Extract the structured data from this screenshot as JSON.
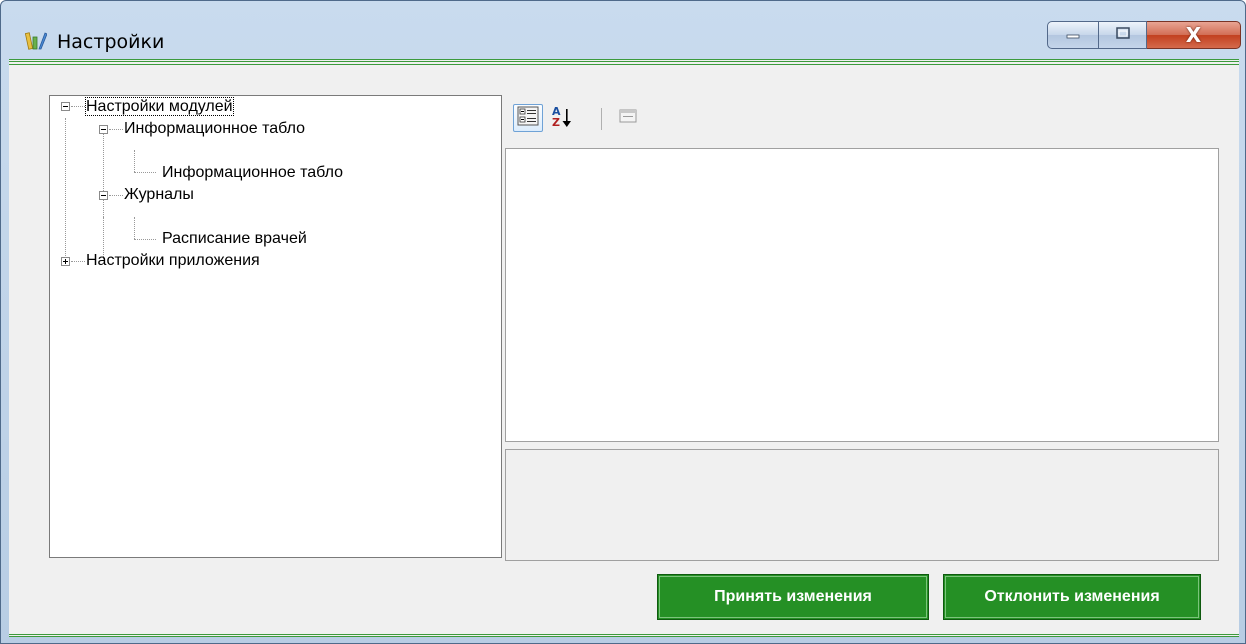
{
  "window": {
    "title": "Настройки",
    "close_glyph": "X"
  },
  "tree": {
    "nodes": [
      {
        "label": "Настройки модулей",
        "expanded": true
      },
      {
        "label": "Информационное табло",
        "expanded": true
      },
      {
        "label": "Информационное табло"
      },
      {
        "label": "Журналы",
        "expanded": true
      },
      {
        "label": "Расписание врачей"
      },
      {
        "label": "Настройки приложения",
        "expanded": false
      }
    ]
  },
  "toolbar": {
    "categorized_icon": "categorized-icon",
    "alphabetical_icon": "sort-az-icon",
    "property_pages_icon": "property-pages-icon",
    "alpha_label_a": "A",
    "alpha_label_z": "Z"
  },
  "buttons": {
    "accept": "Принять изменения",
    "reject": "Отклонить изменения"
  },
  "colors": {
    "accent_green": "#259025",
    "border_green": "#3c9a3c"
  }
}
